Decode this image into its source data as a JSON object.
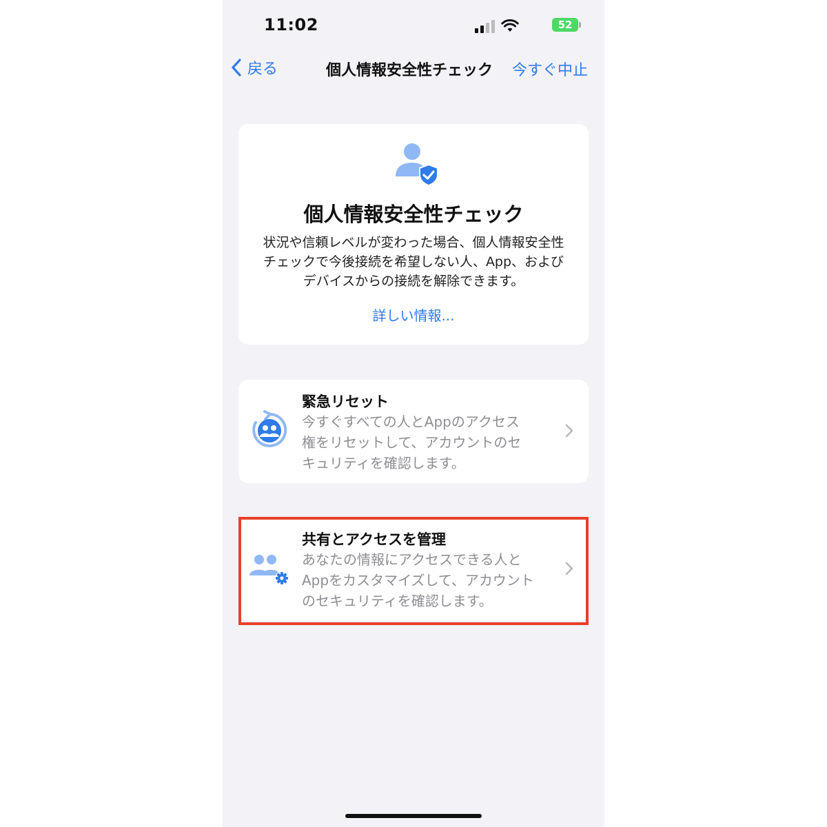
{
  "status_bar": {
    "time": "11:02",
    "battery": "52"
  },
  "nav": {
    "back_label": "戻る",
    "title": "個人情報安全性チェック",
    "stop_label": "今すぐ中止"
  },
  "intro": {
    "icon": "person-shield-check-icon",
    "title": "個人情報安全性チェック",
    "description_lines": [
      "状況や信頼レベルが変わった場合、個人情報安全性",
      "チェックで今後接続を希望しない人、App、および",
      "デバイスからの接続を解除できます。"
    ],
    "more_link": "詳しい情報..."
  },
  "options": [
    {
      "icon": "emergency-reset-icon",
      "title": "緊急リセット",
      "description_lines": [
        "今すぐすべての人とAppのアクセス",
        "権をリセットして、アカウントのセ",
        "キュリティを確認します。"
      ]
    },
    {
      "icon": "people-gear-icon",
      "title": "共有とアクセスを管理",
      "description_lines": [
        "あなたの情報にアクセスできる人と",
        "Appをカスタマイズして、アカウント",
        "のセキュリティを確認します。"
      ]
    }
  ],
  "colors": {
    "accent": "#2f7bea",
    "icon_blue": "#8fb8f5",
    "highlight": "#e8402a",
    "background": "#f2f2f7",
    "secondary_text": "#8e8e93"
  }
}
